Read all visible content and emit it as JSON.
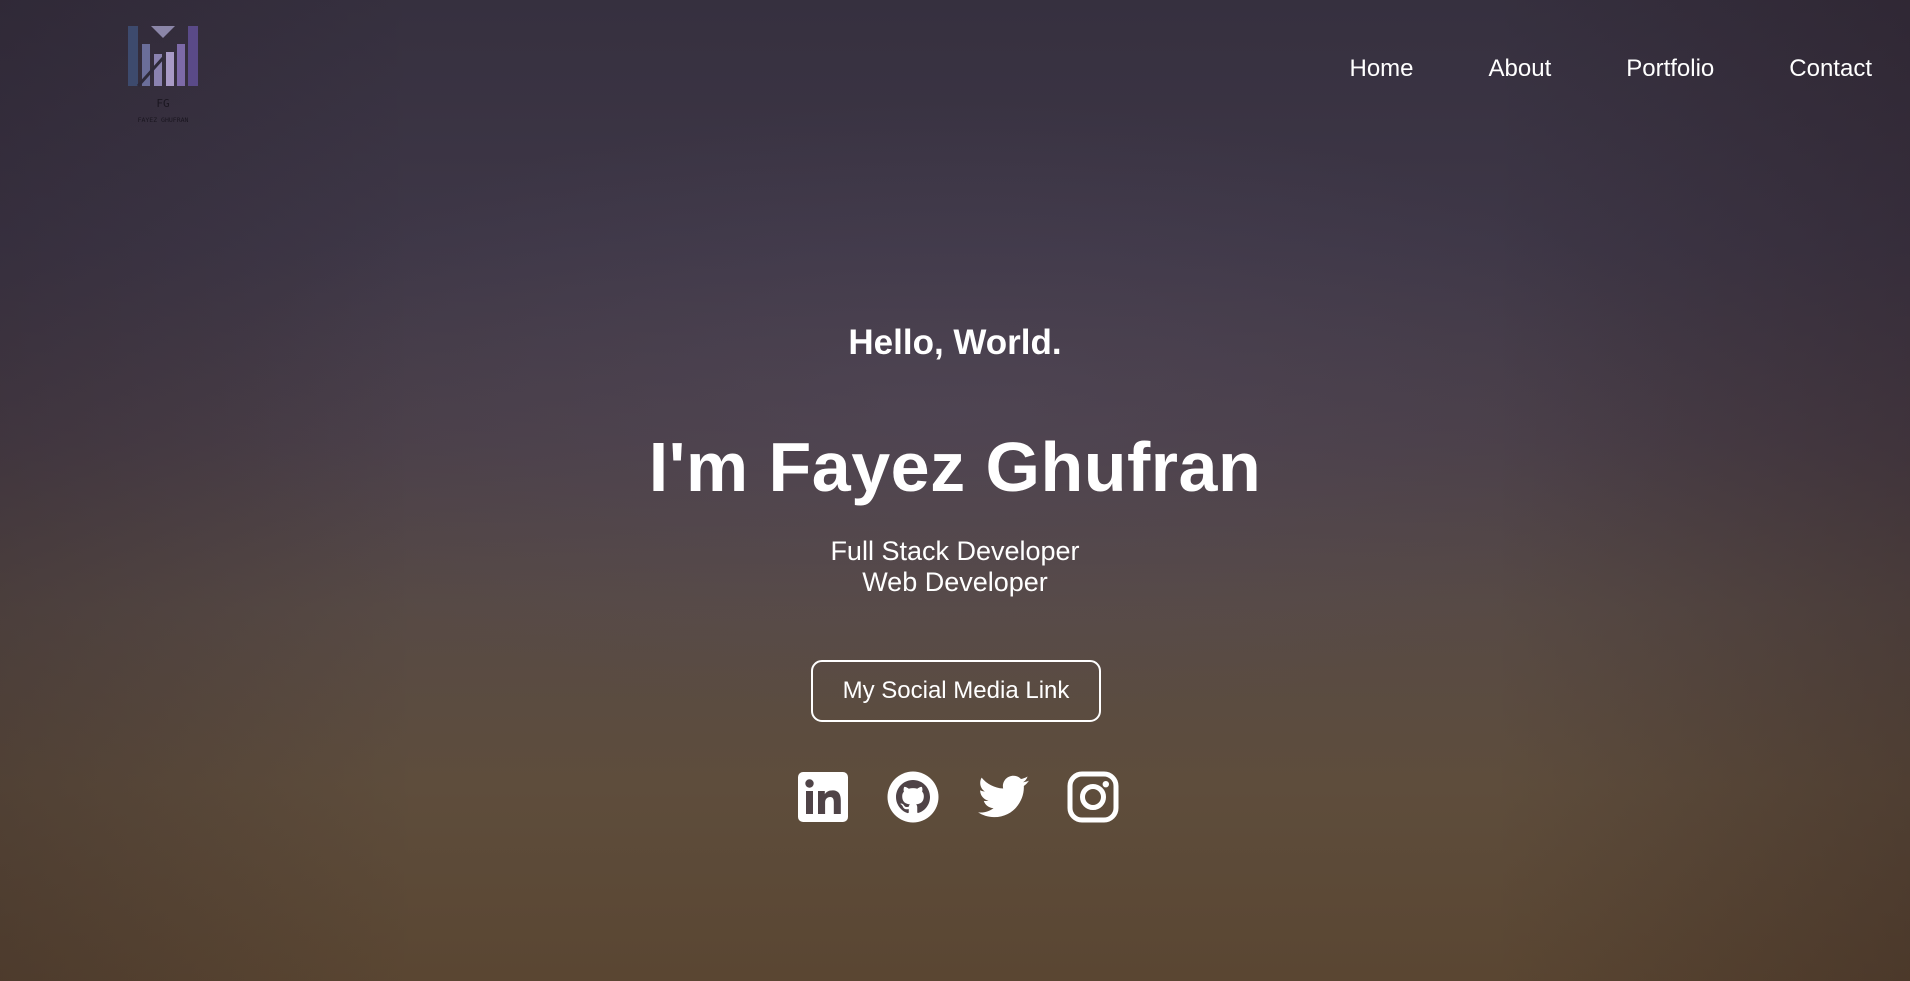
{
  "brand": {
    "initials": "FG",
    "name": "FAYEZ GHUFRAN",
    "logo_icon": "m-monogram-logo"
  },
  "nav": {
    "items": [
      {
        "label": "Home"
      },
      {
        "label": "About"
      },
      {
        "label": "Portfolio"
      },
      {
        "label": "Contact"
      }
    ]
  },
  "hero": {
    "greeting": "Hello, World.",
    "name": "I'm Fayez Ghufran",
    "roles": [
      "Full Stack Developer",
      "Web Developer"
    ],
    "cta_label": "My Social Media Link"
  },
  "social": [
    {
      "icon": "linkedin-icon"
    },
    {
      "icon": "github-icon"
    },
    {
      "icon": "twitter-icon"
    },
    {
      "icon": "instagram-icon"
    }
  ],
  "colors": {
    "text": "#ffffff",
    "background_top": "#36303f",
    "background_bottom": "#5a4632",
    "logo_purple": "#5a4a86",
    "logo_blue": "#3d4a6e"
  }
}
